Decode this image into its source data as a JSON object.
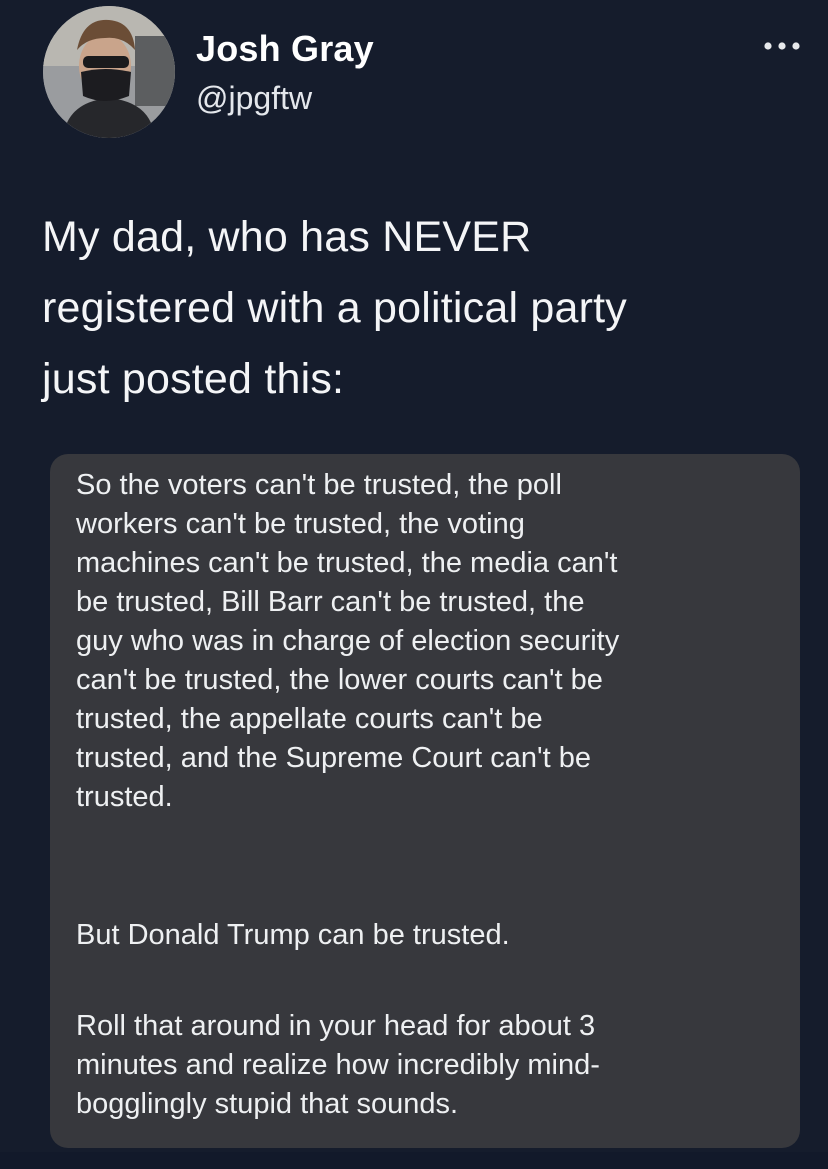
{
  "user": {
    "display_name": "Josh Gray",
    "handle": "@jpgftw",
    "avatar_icon": "profile-photo"
  },
  "menu": {
    "icon": "more-options-icon"
  },
  "tweet": {
    "lines": [
      "My dad, who has NEVER",
      "registered with a political party",
      "just posted this:"
    ]
  },
  "quote": {
    "paragraph1": [
      "So the voters can't be trusted, the poll",
      "workers can't be trusted, the voting",
      "machines can't be trusted, the media can't",
      "be trusted, Bill Barr can't be trusted, the",
      "guy who was in charge of election security",
      "can't be trusted, the lower courts can't be",
      "trusted, the appellate courts can't be",
      "trusted, and the Supreme Court can't be",
      "trusted."
    ],
    "paragraph2": [
      "But Donald Trump can be trusted."
    ],
    "paragraph3": [
      "Roll that around in your head for about 3",
      "minutes and realize how incredibly mind-",
      "bogglingly stupid that sounds."
    ]
  },
  "colors": {
    "background": "#151c2c",
    "card": "#37383d",
    "text": "#f4f5f7"
  }
}
